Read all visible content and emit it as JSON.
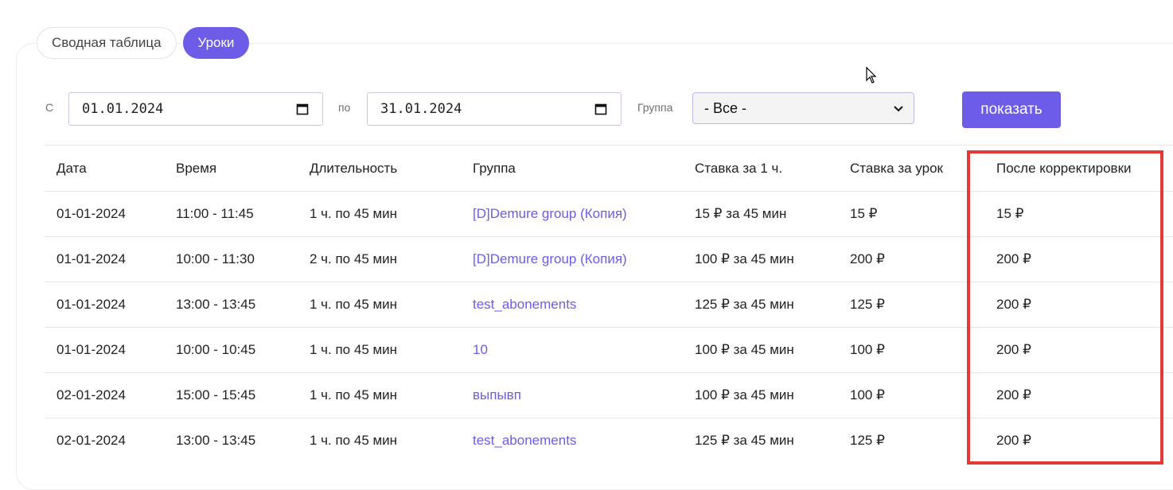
{
  "tabs": {
    "summary": "Сводная таблица",
    "lessons": "Уроки"
  },
  "filters": {
    "from_label": "С",
    "from_value": "01.01.2024",
    "to_label": "по",
    "to_value": "31.01.2024",
    "group_label": "Группа",
    "group_selected": "- Все -",
    "show_button": "показать"
  },
  "table": {
    "headers": [
      "Дата",
      "Время",
      "Длительность",
      "Группа",
      "Ставка за 1 ч.",
      "Ставка за урок",
      "После корректировки"
    ],
    "rows": [
      [
        "01-01-2024",
        "11:00 - 11:45",
        "1 ч. по 45 мин",
        "[D]Demure group (Копия)",
        "15 ₽ за 45 мин",
        "15 ₽",
        "15 ₽"
      ],
      [
        "01-01-2024",
        "10:00 - 11:30",
        "2 ч. по 45 мин",
        "[D]Demure group (Копия)",
        "100 ₽ за 45 мин",
        "200 ₽",
        "200 ₽"
      ],
      [
        "01-01-2024",
        "13:00 - 13:45",
        "1 ч. по 45 мин",
        "test_abonements",
        "125 ₽ за 45 мин",
        "125 ₽",
        "200 ₽"
      ],
      [
        "01-01-2024",
        "10:00 - 10:45",
        "1 ч. по 45 мин",
        "10",
        "100 ₽ за 45 мин",
        "100 ₽",
        "200 ₽"
      ],
      [
        "02-01-2024",
        "15:00 - 15:45",
        "1 ч. по 45 мин",
        "выпывп",
        "100 ₽ за 45 мин",
        "100 ₽",
        "200 ₽"
      ],
      [
        "02-01-2024",
        "13:00 - 13:45",
        "1 ч. по 45 мин",
        "test_abonements",
        "125 ₽ за 45 мин",
        "125 ₽",
        "200 ₽"
      ]
    ]
  },
  "colors": {
    "accent": "#6c5ce7",
    "highlight": "#e53935"
  }
}
